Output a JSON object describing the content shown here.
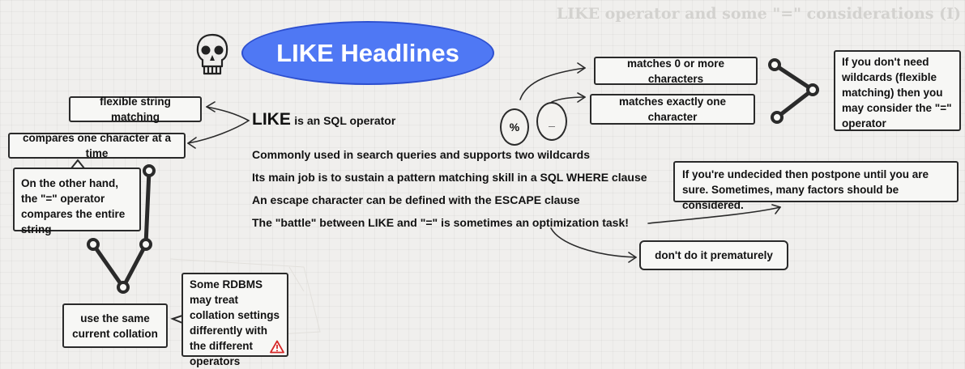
{
  "page_title": "LIKE operator and some \"=\" considerations (I)",
  "headline": "LIKE Headlines",
  "center": {
    "like_word": "LIKE",
    "like_rest": "is an SQL operator",
    "lines": [
      "Commonly used in search queries and supports two wildcards",
      "Its main job is to sustain a pattern matching skill in a SQL WHERE clause",
      "An escape character can be defined with the ESCAPE clause",
      "The \"battle\" between LIKE and \"=\" is sometimes an optimization task!"
    ]
  },
  "left_boxes": {
    "flexible": "flexible string matching",
    "compares": "compares one character at a time",
    "other_hand": "On the other hand, the \"=\" operator compares the entire string",
    "collation": "use the same current collation",
    "rdbms": "Some RDBMS may treat collation settings differently with the different operators"
  },
  "wildcards": {
    "percent_symbol": "%",
    "underscore_symbol": "_",
    "percent_desc": "matches 0 or more characters",
    "underscore_desc": "matches exactly one character",
    "no_wildcards": "If you don't need wildcards (flexible matching) then you may consider the \"=\" operator"
  },
  "right_boxes": {
    "undecided": "If you're undecided then postpone until you are sure. Sometimes, many factors should be considered.",
    "premature": "don't do it prematurely"
  },
  "icons": {
    "skull": "skull-icon",
    "warning": "warning-icon"
  },
  "colors": {
    "headline_fill": "#4f78f4",
    "warning": "#d62828"
  }
}
